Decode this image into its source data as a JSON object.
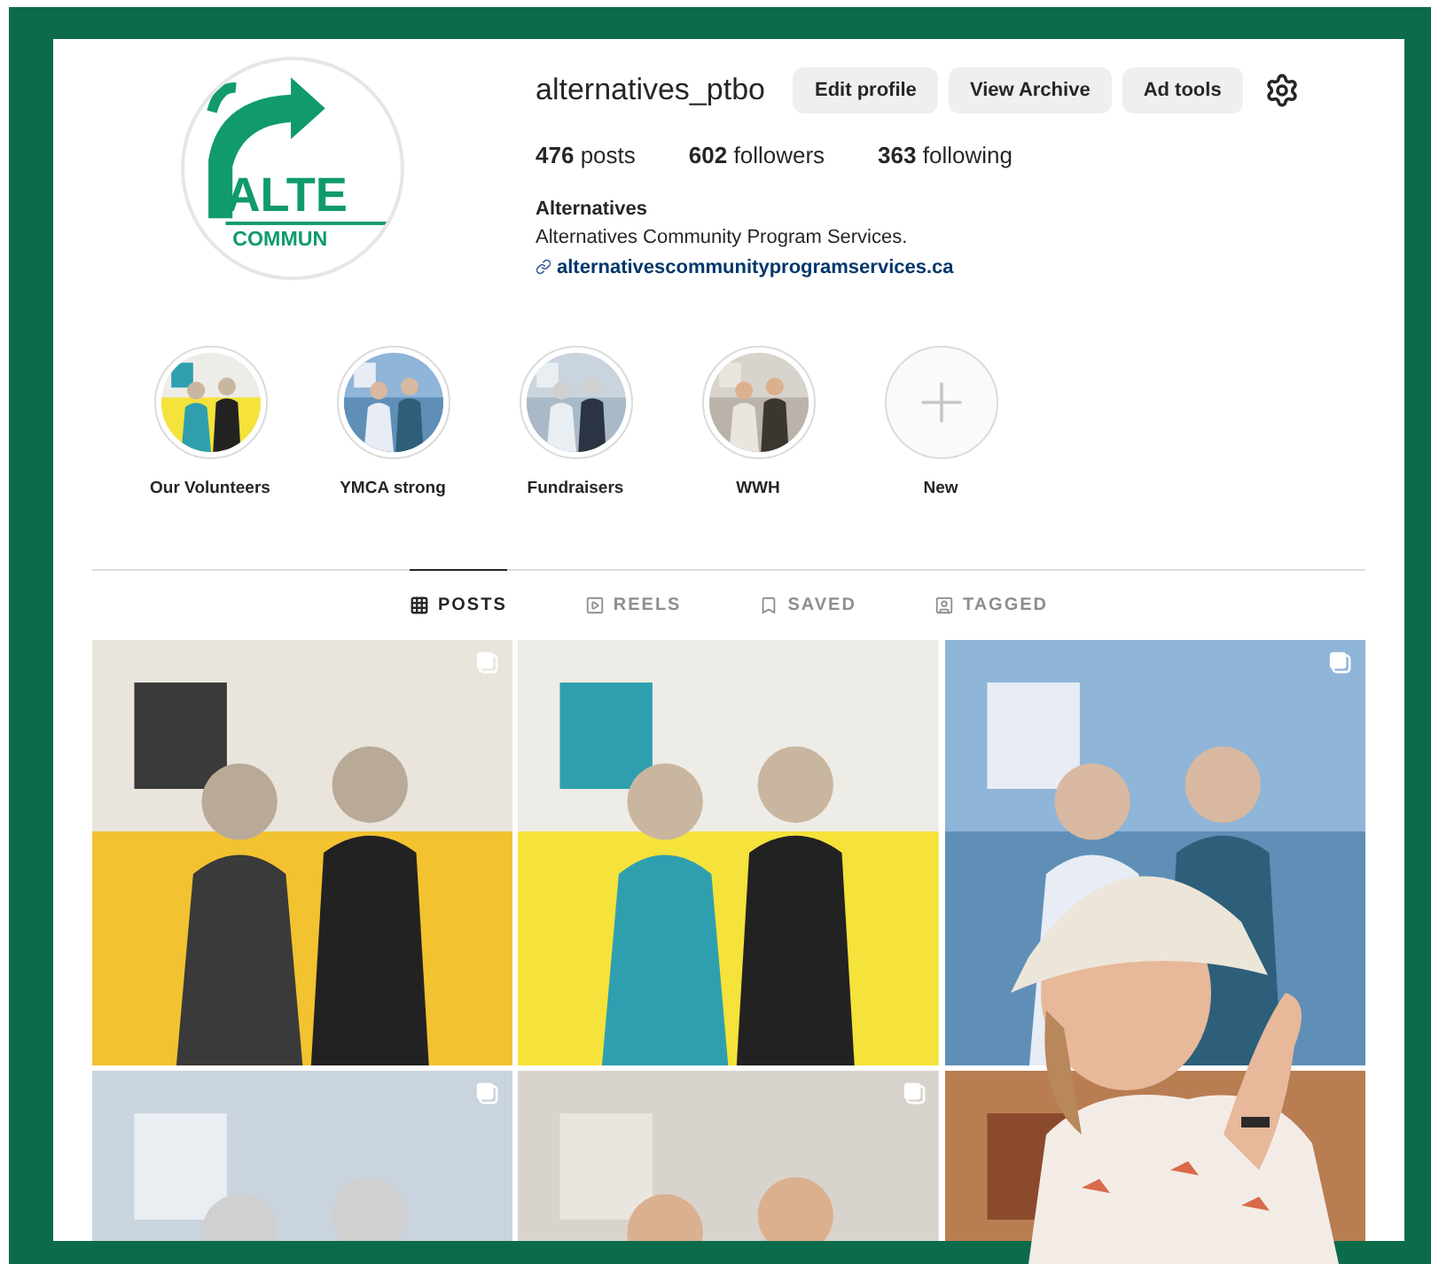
{
  "profile": {
    "logo_text": [
      "ALTE",
      "COMMUN"
    ],
    "username": "alternatives_ptbo",
    "buttons": [
      "Edit profile",
      "View Archive",
      "Ad tools"
    ],
    "stats": [
      {
        "count": "476",
        "label": "posts"
      },
      {
        "count": "602",
        "label": "followers"
      },
      {
        "count": "363",
        "label": "following"
      }
    ],
    "name": "Alternatives",
    "bio": "Alternatives Community Program Services.",
    "link": "alternativescommunityprogramservices.ca"
  },
  "highlights": [
    {
      "label": "Our Volunteers",
      "kind": "picture"
    },
    {
      "label": "YMCA strong",
      "kind": "picture"
    },
    {
      "label": "Fundraisers",
      "kind": "picture"
    },
    {
      "label": "WWH",
      "kind": "picture"
    },
    {
      "label": "New",
      "kind": "new"
    }
  ],
  "tabs": [
    {
      "label": "POSTS",
      "kind": "grid",
      "selected": true
    },
    {
      "label": "REELS",
      "kind": "reels",
      "selected": false
    },
    {
      "label": "SAVED",
      "kind": "saved",
      "selected": false
    },
    {
      "label": "TAGGED",
      "kind": "tagged",
      "selected": false
    }
  ],
  "posts": [
    {
      "multiple": true
    },
    {
      "multiple": false
    },
    {
      "multiple": true
    },
    {
      "multiple": true
    },
    {
      "multiple": true
    },
    {
      "multiple": false
    }
  ]
}
